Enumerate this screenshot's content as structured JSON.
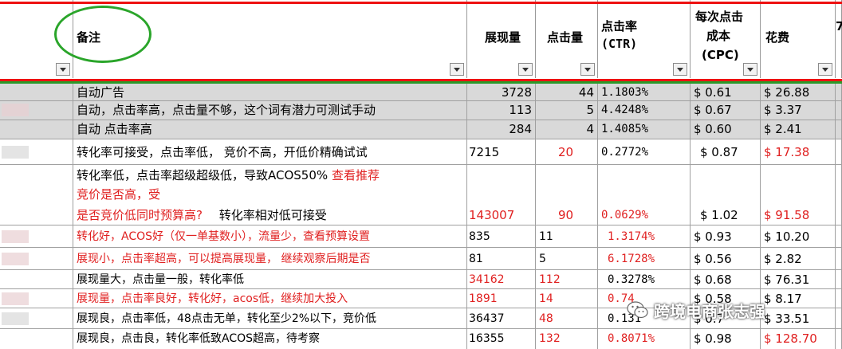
{
  "headers": {
    "note": "备注",
    "impressions": "展现量",
    "clicks": "点击量",
    "ctr_line1": "点击率",
    "ctr_line2": "(CTR)",
    "cpc_line1": "每次点击",
    "cpc_line2": "成本",
    "cpc_line3": "(CPC)",
    "cost": "花费",
    "more": "7"
  },
  "rows": [
    {
      "note": "自动广告",
      "imp": "3728",
      "clk": "44",
      "ctr": "1.1803%",
      "cpc": "$ 0.61",
      "cost": "$ 26.88",
      "style": "gray"
    },
    {
      "note": "自动，点击率高，点击量不够，这个词有潜力可测试手动",
      "imp": "113",
      "clk": "5",
      "ctr": "4.4248%",
      "cpc": "$ 0.67",
      "cost": "$ 3.37",
      "style": "gray"
    },
    {
      "note": "自动 点击率高",
      "imp": "284",
      "clk": "4",
      "ctr": "1.4085%",
      "cpc": "$ 0.60",
      "cost": "$ 2.41",
      "style": "gray"
    },
    {
      "note": "转化率可接受，点击率低， 竞价不高，开低价精确试试",
      "imp": "7215",
      "clk": "20",
      "ctr": "0.2772%",
      "cpc": "$ 0.87",
      "cost": "$ 17.38",
      "style": "white"
    },
    {
      "note_line1_a": "转化率低，点击率超级超级低，导致ACOS50%",
      "note_line1_b": "查看推荐",
      "note_line2": "竞价是否高，受",
      "note_line3_a": "是否竞价低同时预算高?",
      "note_line3_b": "转化率相对低可接受",
      "imp": "143007",
      "clk": "90",
      "ctr": "0.0629%",
      "cpc": "$ 1.02",
      "cost": "$ 91.58",
      "style": "white"
    },
    {
      "note": "转化好，ACOS好（仅一单基数小），流量少，查看预算设置",
      "imp": "835",
      "clk": "11",
      "ctr": "1.3174%",
      "cpc": "$ 0.93",
      "cost": "$ 10.20",
      "style": "white"
    },
    {
      "note": "展现小，点击率超高，可以提高展现量， 继续观察后期是否",
      "imp": "81",
      "clk": "5",
      "ctr": "6.1728%",
      "cpc": "$ 0.56",
      "cost": "$ 2.82",
      "style": "white"
    },
    {
      "note": "展现量大，点击量一般，转化率低",
      "imp": "34162",
      "clk": "112",
      "ctr": "0.3278%",
      "cpc": "$ 0.68",
      "cost": "$ 76.31",
      "style": "white"
    },
    {
      "note": "展现量，点击率良好，转化好，acos低，继续加大投入",
      "imp": "1891",
      "clk": "14",
      "ctr": "0.74",
      "cpc": "$ 0.58",
      "cost": "$ 8.17",
      "style": "white"
    },
    {
      "note": "展现良，点击率低，48点击无单，转化至少2%以下，竞价低",
      "imp": "36437",
      "clk": "48",
      "ctr": "0.131",
      "cpc": "$ 0.7",
      "cost": "$ 33.51",
      "style": "white"
    },
    {
      "note": "展现良，点击良，转化率低致ACOS超高，待考察",
      "imp": "16355",
      "clk": "132",
      "ctr": "0.8071%",
      "cpc": "$ 0.98",
      "cost": "$ 128.70",
      "style": "white"
    }
  ],
  "watermark": {
    "text": "跨境电商张志强",
    "icon": "wechat-icon"
  },
  "colors": {
    "red_line": "#e11111",
    "green_line": "#2a9a2a",
    "highlight_circle": "#2aa52a",
    "red_text": "#e02020",
    "gray_row": "#d9d9d9"
  }
}
